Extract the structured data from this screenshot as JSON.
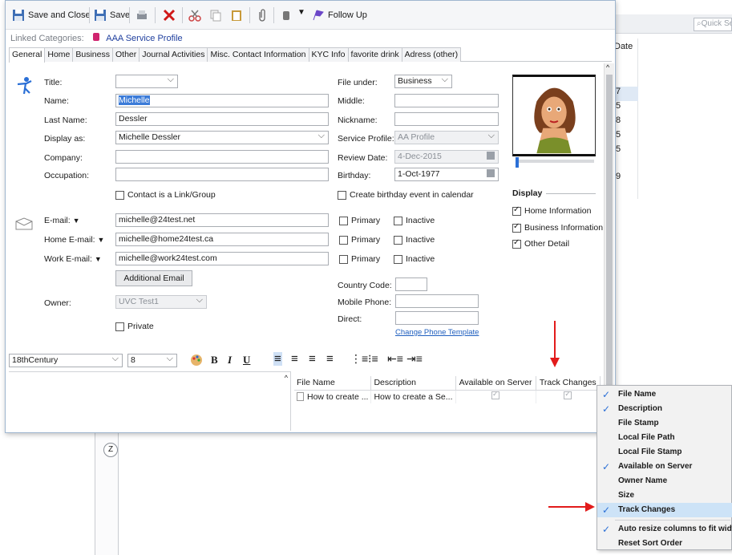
{
  "background": {
    "search_placeholder": "Quick Se",
    "search_icon": "magnifier-icon",
    "column_header": "Date",
    "column_cells": [
      "7",
      "5",
      "8",
      "5",
      "5",
      "9"
    ],
    "letter_button": "Z"
  },
  "toolbar": {
    "save_close": "Save and Close",
    "save": "Save",
    "follow_up": "Follow Up",
    "icons": [
      "save-disk-icon",
      "print-icon",
      "delete-x-icon",
      "scissors-icon",
      "copy-icon",
      "paste-icon",
      "paperclip-icon",
      "hand-icon",
      "dropdown-icon",
      "flag-icon"
    ]
  },
  "linked": {
    "label": "Linked Categories:",
    "value": "AAA Service Profile"
  },
  "tabs": [
    "General",
    "Home",
    "Business",
    "Other",
    "Journal Activities",
    "Misc. Contact Information",
    "KYC Info",
    "favorite drink",
    "Adress (other)"
  ],
  "form": {
    "title_label": "Title:",
    "title_value": "",
    "name_label": "Name:",
    "name_value": "Michelle",
    "last_label": "Last Name:",
    "last_value": "Dessler",
    "display_label": "Display as:",
    "display_value": "Michelle Dessler",
    "company_label": "Company:",
    "company_value": "",
    "occupation_label": "Occupation:",
    "occupation_value": "",
    "contact_link": "Contact is a Link/Group",
    "file_under_label": "File under:",
    "file_under_value": "Business",
    "middle_label": "Middle:",
    "middle_value": "",
    "nickname_label": "Nickname:",
    "nickname_value": "",
    "service_label": "Service Profile:",
    "service_value": "AA Profile",
    "review_label": "Review Date:",
    "review_value": "4-Dec-2015",
    "birthday_label": "Birthday:",
    "birthday_value": "1-Oct-1977",
    "birthday_event": "Create birthday event in calendar",
    "email_label": "E-mail:",
    "email_value": "michelle@24test.net",
    "home_email_label": "Home E-mail:",
    "home_email_value": "michelle@home24test.ca",
    "work_email_label": "Work E-mail:",
    "work_email_value": "michelle@work24test.com",
    "primary": "Primary",
    "inactive": "Inactive",
    "additional_email": "Additional Email",
    "owner_label": "Owner:",
    "owner_value": "UVC Test1",
    "private": "Private",
    "country_label": "Country Code:",
    "country_value": "",
    "mobile_label": "Mobile Phone:",
    "mobile_value": "",
    "direct_label": "Direct:",
    "direct_value": "",
    "change_phone": "Change Phone Template"
  },
  "display_panel": {
    "heading": "Display",
    "options": [
      "Home Information",
      "Business Information",
      "Other Detail"
    ]
  },
  "editor": {
    "font": "18thCentury",
    "size": "8",
    "bold": "B",
    "italic": "I",
    "underline": "U"
  },
  "attachments": {
    "headers": [
      "File Name",
      "Description",
      "Available on Server",
      "Track Changes"
    ],
    "rows": [
      {
        "file": "How to create ...",
        "desc": "How to create a Se..."
      }
    ]
  },
  "context_menu": {
    "items": [
      {
        "label": "File Name",
        "checked": true
      },
      {
        "label": "Description",
        "checked": true
      },
      {
        "label": "File Stamp",
        "checked": false
      },
      {
        "label": "Local File Path",
        "checked": false
      },
      {
        "label": "Local File Stamp",
        "checked": false
      },
      {
        "label": "Available on Server",
        "checked": true
      },
      {
        "label": "Owner Name",
        "checked": false
      },
      {
        "label": "Size",
        "checked": false
      },
      {
        "label": "Track Changes",
        "checked": true
      }
    ],
    "extra": [
      {
        "label": "Auto resize columns to fit width",
        "checked": true
      },
      {
        "label": "Reset Sort Order",
        "checked": false
      }
    ]
  },
  "colors": {
    "arrow": "#e21b1b",
    "accent": "#2a6fd6",
    "highlight": "#cde3f7"
  }
}
